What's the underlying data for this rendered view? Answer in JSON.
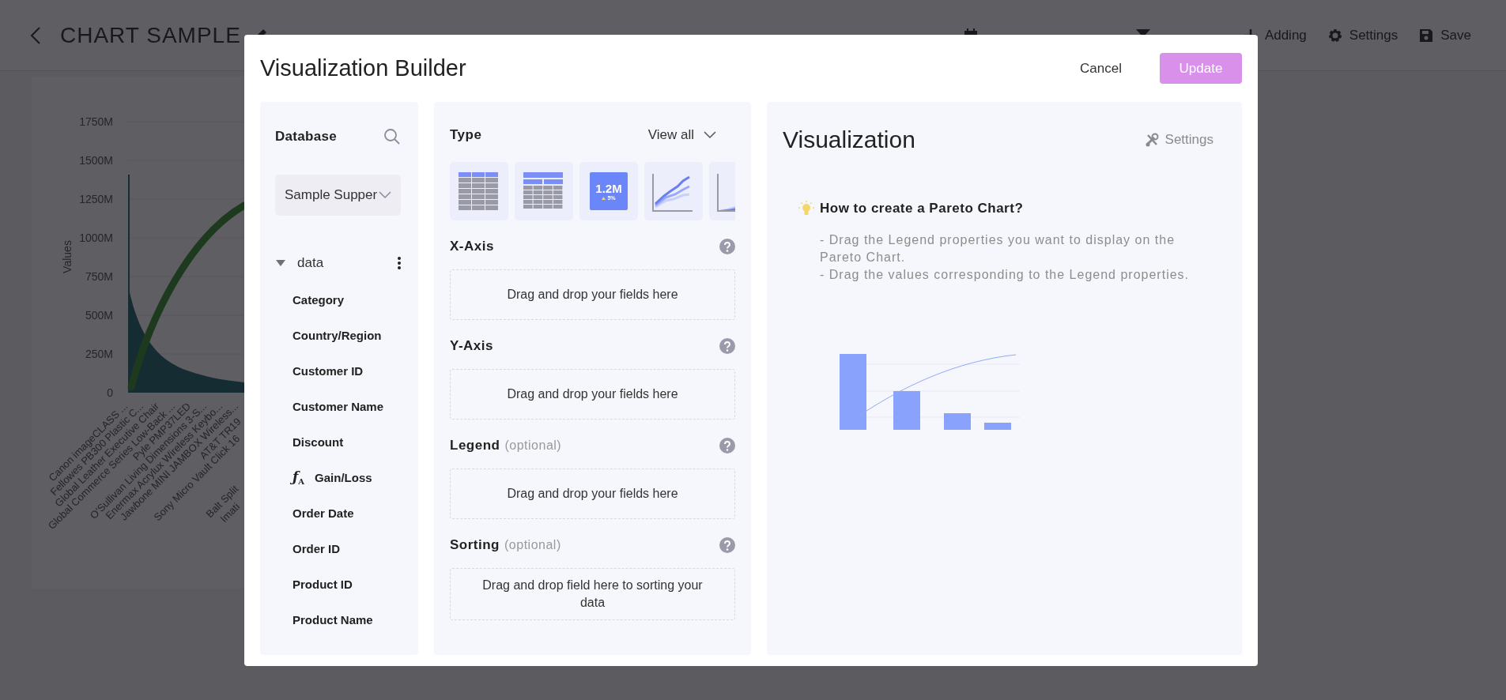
{
  "top_bar": {
    "title": "CHART SAMPLE",
    "actions": [
      {
        "kind": "calendar"
      },
      {
        "kind": "filter"
      },
      {
        "kind": "add",
        "label": "Adding"
      },
      {
        "kind": "settings",
        "label": "Settings"
      },
      {
        "kind": "save",
        "label": "Save"
      }
    ]
  },
  "background_chart": {
    "ylabel": "Values",
    "yticks": [
      "1750M",
      "1500M",
      "1250M",
      "1000M",
      "750M",
      "500M",
      "250M",
      "0"
    ],
    "x_labels": [
      "Canon imageCLASS ...",
      "Fellowes PB300 Plastic C...",
      "Global Leather Executive Chair",
      "Global Commerce Series Low-Back ...",
      "Pyle PMP37LED",
      "O'Sullivan Living Dimensions 3-S...",
      "Enermax Acrylux Wireless Keybo...",
      "Jawbone MINI JAMBOX Wireless..."
    ],
    "cut_labels": [
      "AT&T TR19",
      "Sony Micro Vault Click 16",
      "Balt Split",
      "Imati"
    ]
  },
  "dialog": {
    "title": "Visualization Builder",
    "buttons": [
      {
        "kind": "cancel",
        "label": "Cancel"
      },
      {
        "kind": "primary",
        "label": "Update",
        "disabled": true
      }
    ],
    "database": {
      "title": "Database",
      "source": "Sample Supper",
      "tree": [
        {
          "label": "data",
          "expanded": true,
          "children": [
            {
              "label": "Category",
              "kind": "field"
            },
            {
              "label": "Country/Region",
              "kind": "field"
            },
            {
              "label": "Customer ID",
              "kind": "field"
            },
            {
              "label": "Customer Name",
              "kind": "field"
            },
            {
              "label": "Discount",
              "kind": "field"
            },
            {
              "label": "Gain/Loss",
              "kind": "formula",
              "icon": "ƒ$_{A}$"
            },
            {
              "label": "Order Date",
              "kind": "field"
            },
            {
              "label": "Order ID",
              "kind": "field"
            },
            {
              "label": "Product ID",
              "kind": "field"
            },
            {
              "label": "Product Name",
              "kind": "field"
            }
          ]
        }
      ]
    },
    "builder": {
      "type_label": "Type",
      "view_all": "View all",
      "chart_types": [
        {
          "kind": "table"
        },
        {
          "kind": "pivot"
        },
        {
          "kind": "kpi",
          "value": "1.2M",
          "change": "5%"
        },
        {
          "kind": "line"
        },
        {
          "kind": "area"
        }
      ],
      "sections": [
        {
          "label": "X-Axis",
          "hint": "Drag and drop your fields here"
        },
        {
          "label": "Y-Axis",
          "hint": "Drag and drop your fields here"
        },
        {
          "label": "Legend",
          "optional": "(optional)",
          "hint": "Drag and drop your fields here"
        },
        {
          "label": "Sorting",
          "optional": "(optional)",
          "hint": "Drag and drop field here to sorting your data"
        }
      ]
    },
    "visualization": {
      "title": "Visualization",
      "settings": {
        "label": "Settings",
        "disabled": true
      },
      "tip": {
        "heading": "How to create a Pareto Chart?",
        "lines": [
          "- Drag the Legend properties you want to display on the Pareto Chart.",
          "- Drag the values corresponding to the Legend properties."
        ]
      }
    }
  }
}
